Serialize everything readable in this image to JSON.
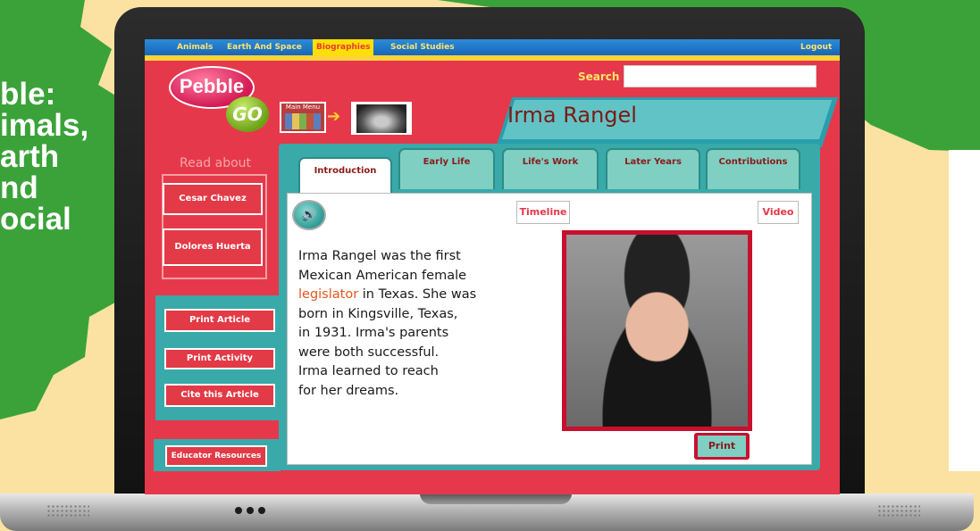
{
  "promo": {
    "lines": [
      "ble:",
      "imals,",
      "arth",
      "nd",
      "ocial"
    ]
  },
  "nav": {
    "items": [
      "Animals",
      "Earth And Space",
      "Biographies",
      "Social Studies"
    ],
    "active": "Biographies",
    "logout": "Logout"
  },
  "logo": {
    "word1": "Pebble",
    "word2": "GO"
  },
  "search": {
    "label": "Search",
    "value": ""
  },
  "main_menu": {
    "label": "Main Menu"
  },
  "page": {
    "title": "Irma Rangel"
  },
  "tabs": [
    "Introduction",
    "Early Life",
    "Life's Work",
    "Later Years",
    "Contributions"
  ],
  "active_tab": "Introduction",
  "sidebar": {
    "read_about": "Read about",
    "related": [
      "Cesar Chavez",
      "Dolores Huerta"
    ],
    "tools": [
      "Print Article",
      "Print Activity",
      "Cite this Article"
    ],
    "educator": "Educator Resources"
  },
  "content": {
    "timeline_label": "Timeline",
    "video_label": "Video",
    "print_label": "Print",
    "article_lines": [
      "Irma Rangel was the first",
      "Mexican American female",
      "in Texas. She was",
      "born in Kingsville, Texas,",
      "in 1931. Irma's parents",
      "were both successful.",
      "Irma learned to reach",
      "for her dreams."
    ],
    "keyword": "legislator"
  },
  "colors": {
    "nav_blue": "#1766b8",
    "screen_red": "#e6384b",
    "teal": "#39a9a9",
    "title_brown": "#7b1b14",
    "promo_green": "#3ba23a"
  }
}
